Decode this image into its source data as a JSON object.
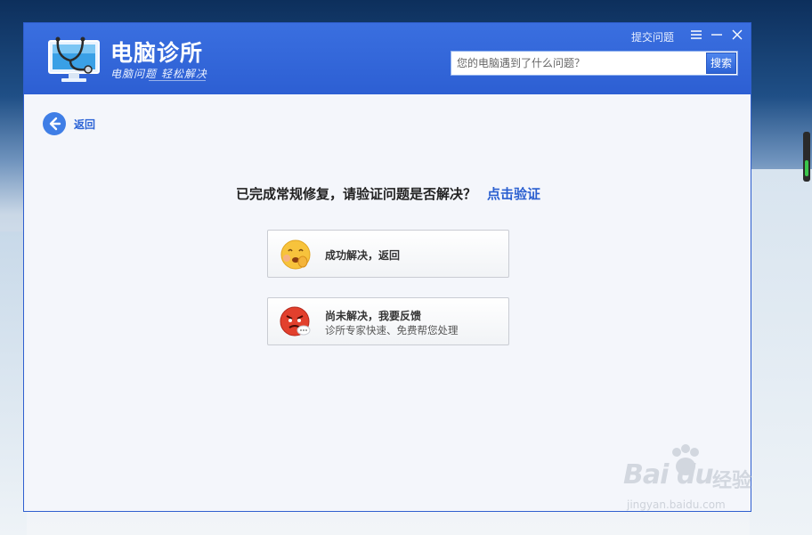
{
  "app": {
    "title": "电脑诊所",
    "subtitle": "电脑问题 轻松解决"
  },
  "header": {
    "feedback_link": "提交问题",
    "search": {
      "placeholder": "您的电脑遇到了什么问题？",
      "button_label": "搜索"
    }
  },
  "nav": {
    "back_label": "返回"
  },
  "main": {
    "prompt": "已完成常规修复，请验证问题是否解决？",
    "verify_link": "点击验证",
    "options": [
      {
        "title": "成功解决，返回",
        "subtitle": ""
      },
      {
        "title": "尚未解决，我要反馈",
        "subtitle": "诊所专家快速、免费帮您处理"
      }
    ]
  },
  "watermark": {
    "brand": "Bai  du",
    "cn": "经验",
    "url": "jingyan.baidu.com"
  },
  "colors": {
    "titlebar": "#2f63d6",
    "accent": "#2a5fd0",
    "window_bg": "#f4f6fb"
  }
}
